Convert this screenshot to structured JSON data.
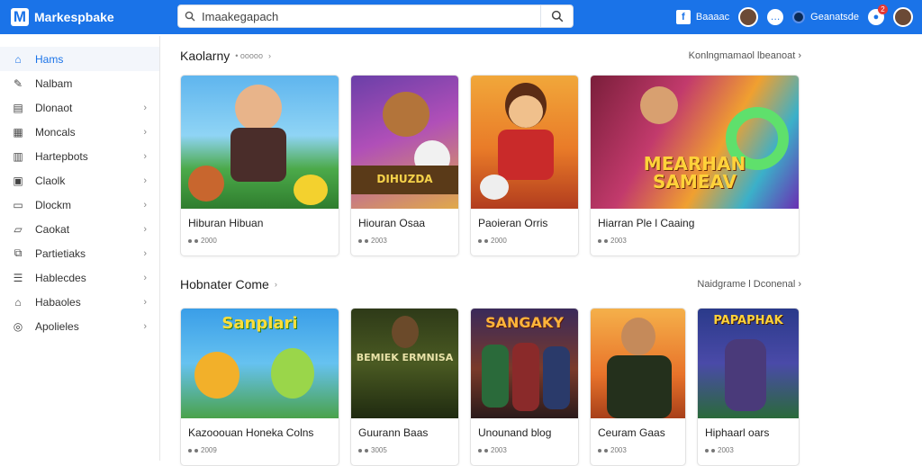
{
  "app": {
    "logo_letter": "M",
    "title": "Markespbake"
  },
  "search": {
    "value": "Imaakegapach",
    "placeholder": "Imaakegapach"
  },
  "topbar": {
    "items": [
      {
        "label": "Baaaac"
      },
      {
        "label": "Geanatsde"
      }
    ],
    "notif_count": "2"
  },
  "sidebar": {
    "items": [
      {
        "label": "Hams",
        "icon": "home-icon",
        "active": true
      },
      {
        "label": "Nalbam",
        "icon": "pencil-icon"
      },
      {
        "label": "Dlonaot",
        "icon": "calendar-icon",
        "chevron": true
      },
      {
        "label": "Moncals",
        "icon": "grid-icon",
        "chevron": true
      },
      {
        "label": "Hartepbots",
        "icon": "dashboard-icon",
        "chevron": true
      },
      {
        "label": "Claolk",
        "icon": "clock-icon",
        "chevron": true
      },
      {
        "label": "Dlockm",
        "icon": "document-icon",
        "chevron": true
      },
      {
        "label": "Caokat",
        "icon": "folder-icon",
        "chevron": true
      },
      {
        "label": "Partietiaks",
        "icon": "share-icon",
        "chevron": true
      },
      {
        "label": "Hablecdes",
        "icon": "list-icon",
        "chevron": true
      },
      {
        "label": "Habaoles",
        "icon": "house-icon",
        "chevron": true
      },
      {
        "label": "Apolieles",
        "icon": "compass-icon",
        "chevron": true
      }
    ]
  },
  "sections": [
    {
      "title": "Kaolarny",
      "subtitle": "• ooooo",
      "link": "Konlngmamaol lbeanoat",
      "cards": [
        {
          "title": "Hiburan Hibuan",
          "meta": "2000",
          "art": ""
        },
        {
          "title": "Hiouran Osaa",
          "meta": "2003",
          "art": "DIHUZDA"
        },
        {
          "title": "Paoieran Orris",
          "meta": "2000",
          "art": ""
        },
        {
          "title": "Hiarran Ple l Caaing",
          "meta": "2003",
          "art": "MEARHAN SAMEAV"
        }
      ]
    },
    {
      "title": "Hobnater Come",
      "subtitle": "",
      "link": "Naidgrame l Dconenal",
      "cards": [
        {
          "title": "Kazooouan Honeka Colns",
          "meta": "2009",
          "art": "Sanplari"
        },
        {
          "title": "Guurann Baas",
          "meta": "3005",
          "art": "BEMIEK ERMNISA"
        },
        {
          "title": "Unounand blog",
          "meta": "2003",
          "art": "SANGAKY"
        },
        {
          "title": "Ceuram Gaas",
          "meta": "2003",
          "art": ""
        },
        {
          "title": "Hiphaarl oars",
          "meta": "2003",
          "art": "PAPAPHAK"
        }
      ]
    }
  ],
  "colors": {
    "accent": "#1a73e8"
  }
}
